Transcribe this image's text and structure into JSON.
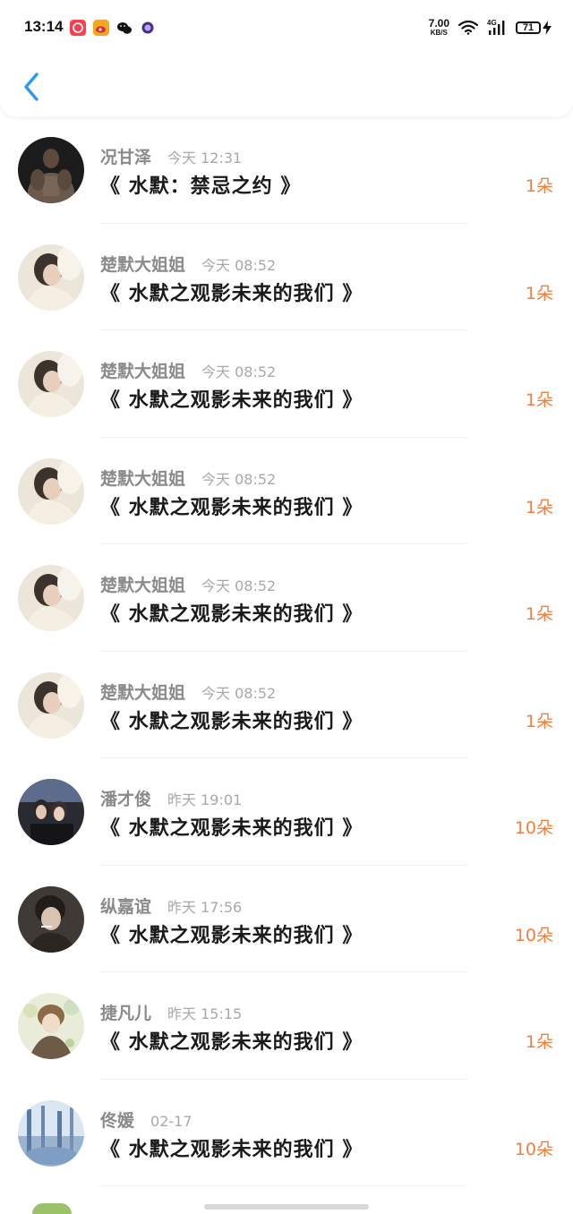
{
  "status_bar": {
    "time": "13:14",
    "net_speed_value": "7.00",
    "net_speed_unit": "KB/S",
    "network_type": "4G",
    "battery": "71",
    "app_icons": [
      "app-red-icon",
      "weibo-icon",
      "wechat-icon",
      "purple-dot-icon"
    ]
  },
  "header": {
    "back_icon": "chevron-left-icon",
    "accent_color": "#2b9af3"
  },
  "colors": {
    "count": "#f07f3c",
    "name": "#8a8a8a",
    "timestamp": "#a8a8a8",
    "title": "#1a1a1a"
  },
  "items": [
    {
      "name": "况甘泽",
      "time": "今天 12:31",
      "title": "《 水默：禁忌之约 》",
      "count": "1朵",
      "avatar": "avatar-muscle-man"
    },
    {
      "name": "楚默大姐姐",
      "time": "今天 08:52",
      "title": "《 水默之观影未来的我们 》",
      "count": "1朵",
      "avatar": "avatar-girl-cream"
    },
    {
      "name": "楚默大姐姐",
      "time": "今天 08:52",
      "title": "《 水默之观影未来的我们 》",
      "count": "1朵",
      "avatar": "avatar-girl-cream"
    },
    {
      "name": "楚默大姐姐",
      "time": "今天 08:52",
      "title": "《 水默之观影未来的我们 》",
      "count": "1朵",
      "avatar": "avatar-girl-cream"
    },
    {
      "name": "楚默大姐姐",
      "time": "今天 08:52",
      "title": "《 水默之观影未来的我们 》",
      "count": "1朵",
      "avatar": "avatar-girl-cream"
    },
    {
      "name": "楚默大姐姐",
      "time": "今天 08:52",
      "title": "《 水默之观影未来的我们 》",
      "count": "1朵",
      "avatar": "avatar-girl-cream"
    },
    {
      "name": "潘才俊",
      "time": "昨天 19:01",
      "title": "《 水默之观影未来的我们 》",
      "count": "10朵",
      "avatar": "avatar-couple"
    },
    {
      "name": "纵嘉谊",
      "time": "昨天 17:56",
      "title": "《 水默之观影未来的我们 》",
      "count": "10朵",
      "avatar": "avatar-smoking-boy"
    },
    {
      "name": "捷凡儿",
      "time": "昨天 15:15",
      "title": "《 水默之观影未来的我们 》",
      "count": "1朵",
      "avatar": "avatar-anime-boy"
    },
    {
      "name": "佟媛",
      "time": "02-17",
      "title": "《 水默之观影未来的我们 》",
      "count": "10朵",
      "avatar": "avatar-blue-forest"
    }
  ]
}
